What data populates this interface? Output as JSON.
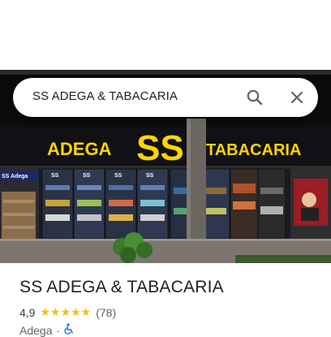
{
  "search": {
    "query": "SS ADEGA & TABACARIA"
  },
  "photo": {
    "sign_left": "ADEGA",
    "sign_logo": "SS",
    "sign_right": "TABACARIA",
    "fridge_logo": "SS",
    "side_banner": "SS Adega"
  },
  "place": {
    "title": "SS ADEGA & TABACARIA",
    "rating": "4,9",
    "stars": "★★★★★",
    "reviews": "(78)",
    "category": "Adega",
    "separator": "·",
    "accessibility_icon": "wheelchair-icon"
  },
  "colors": {
    "sign_yellow": "#ffd400",
    "star": "#fbbc04",
    "accent": "#1a73e8"
  }
}
